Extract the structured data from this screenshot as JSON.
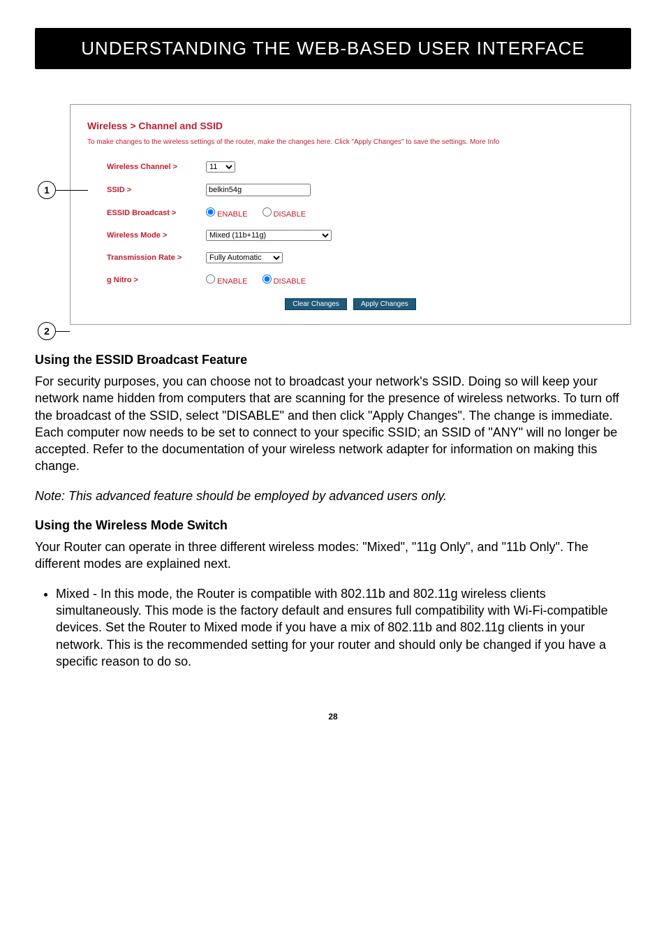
{
  "header": "UNDERSTANDING THE WEB-BASED USER INTERFACE",
  "panel": {
    "title": "Wireless > Channel and SSID",
    "intro_prefix": "To make changes to the wireless settings of the router, make the changes here. Click \"Apply Changes\" to save the settings. ",
    "intro_link": "More Info",
    "labels": {
      "channel": "Wireless Channel >",
      "ssid": "SSID >",
      "essid": "ESSID Broadcast >",
      "mode": "Wireless Mode >",
      "rate": "Transmission Rate >",
      "gnitro": "g Nitro >"
    },
    "values": {
      "channel": "11",
      "ssid": "belkin54g",
      "mode": "Mixed (11b+11g)",
      "rate": "Fully Automatic"
    },
    "radio": {
      "enable": "ENABLE",
      "disable": "DISABLE"
    },
    "buttons": {
      "clear": "Clear Changes",
      "apply": "Apply Changes"
    }
  },
  "callouts": {
    "one": "1",
    "two": "2"
  },
  "sections": {
    "essid_h": "Using the ESSID Broadcast Feature",
    "essid_p": "For security purposes, you can choose not to broadcast your network's SSID. Doing so will keep your network name hidden from computers that are scanning for the presence of wireless networks. To turn off the broadcast of the SSID, select \"DISABLE\" and then click \"Apply Changes\". The change is immediate. Each computer now needs to be set to connect to your specific SSID; an SSID of \"ANY\" will no longer be accepted. Refer to the documentation of your wireless network adapter for information on making this change.",
    "note": "Note: This advanced feature should be employed by advanced users only.",
    "mode_h": "Using the Wireless Mode Switch",
    "mode_p": "Your Router can operate in three different wireless modes: \"Mixed\", \"11g Only\", and \"11b Only\". The different modes are explained next.",
    "bullet1": "Mixed - In this mode, the Router is compatible with 802.11b and 802.11g wireless clients simultaneously. This mode is the factory default and ensures full compatibility with Wi-Fi-compatible devices. Set the Router to Mixed mode if you have a mix of 802.11b and 802.11g clients in your network. This is the recommended setting for your router and should only be changed if you have a specific reason to do so."
  },
  "page": "28"
}
